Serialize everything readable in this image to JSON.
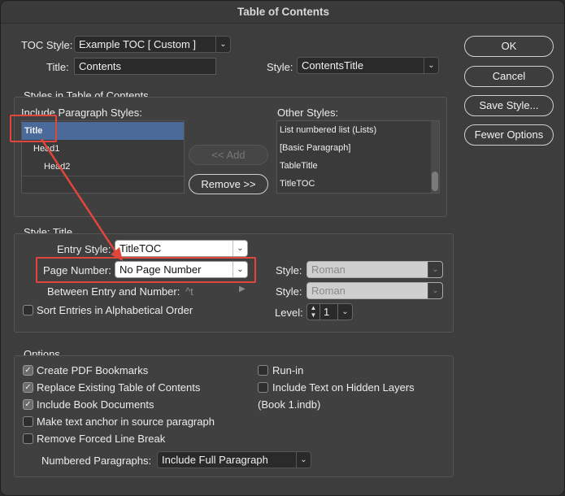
{
  "window": {
    "title": "Table of Contents"
  },
  "top": {
    "toc_style_label": "TOC Style:",
    "toc_style_value": "Example TOC [ Custom ]",
    "title_label": "Title:",
    "title_value": "Contents",
    "style_label": "Style:",
    "style_value": "ContentsTitle"
  },
  "buttons": {
    "ok": "OK",
    "cancel": "Cancel",
    "save_style": "Save Style...",
    "fewer_options": "Fewer Options",
    "add": "<< Add",
    "remove": "Remove >>"
  },
  "styles_panel": {
    "title": "Styles in Table of Contents",
    "include_label": "Include Paragraph Styles:",
    "include_items": [
      "Title",
      "Head1",
      "Head2"
    ],
    "other_label": "Other Styles:",
    "other_items": [
      "List numbered list (Lists)",
      "[Basic Paragraph]",
      "TableTitle",
      "TitleTOC"
    ]
  },
  "style_panel": {
    "title": "Style: Title",
    "entry_style_label": "Entry Style:",
    "entry_style_value": "TitleTOC",
    "page_number_label": "Page Number:",
    "page_number_value": "No Page Number",
    "between_label": "Between Entry and Number:",
    "between_value": "^t",
    "sort_label": "Sort Entries in Alphabetical Order",
    "style_label_1": "Style:",
    "style_value_1": "Roman",
    "style_label_2": "Style:",
    "style_value_2": "Roman",
    "level_label": "Level:",
    "level_value": "1"
  },
  "options": {
    "title": "Options",
    "create_pdf": "Create PDF Bookmarks",
    "replace_existing": "Replace Existing Table of Contents",
    "include_book": "Include Book Documents",
    "make_anchor": "Make text anchor in source paragraph",
    "remove_break": "Remove Forced Line Break",
    "run_in": "Run-in",
    "include_hidden": "Include Text on Hidden Layers",
    "book_name": "(Book 1.indb)",
    "numbered_label": "Numbered Paragraphs:",
    "numbered_value": "Include Full Paragraph",
    "checked": {
      "create_pdf": true,
      "replace_existing": true,
      "include_book": true,
      "make_anchor": false,
      "remove_break": false,
      "run_in": false,
      "include_hidden": false
    }
  },
  "colors": {
    "highlight": "#e0463c",
    "selection": "#4a6a9a"
  }
}
